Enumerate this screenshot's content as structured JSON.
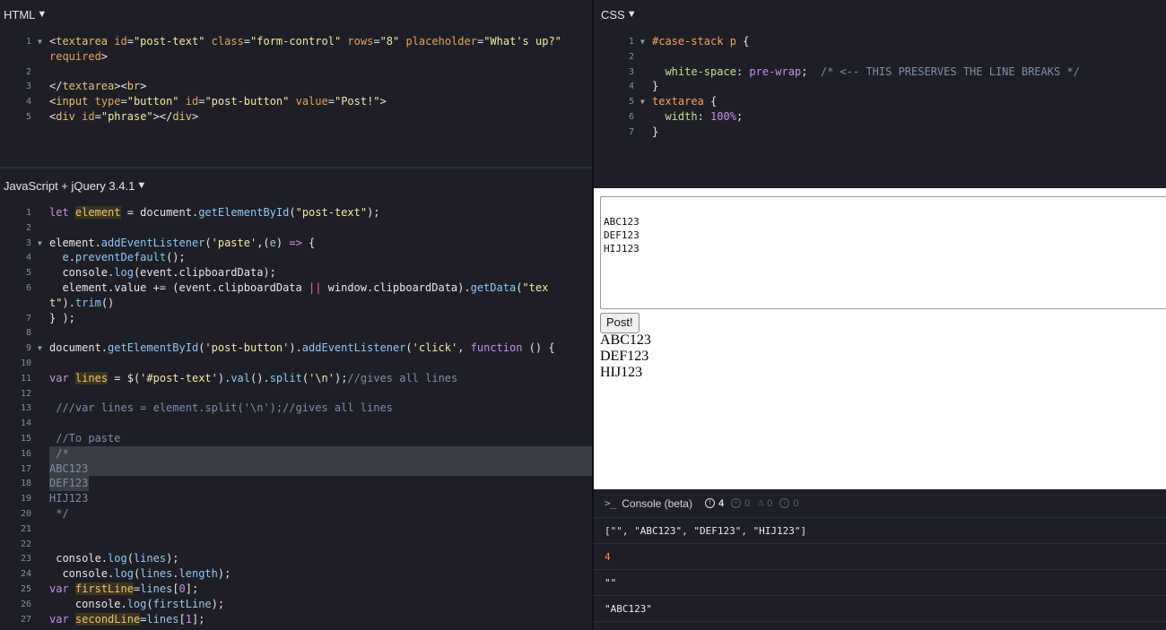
{
  "html_panel": {
    "title": "HTML",
    "lines": [
      {
        "n": "1",
        "fold": true,
        "segs": [
          [
            "t",
            "<"
          ],
          [
            "tag",
            "textarea"
          ],
          [
            "t",
            " "
          ],
          [
            "attr",
            "id"
          ],
          [
            "t",
            "="
          ],
          [
            "str",
            "\"post-text\""
          ],
          [
            "t",
            " "
          ],
          [
            "attr",
            "class"
          ],
          [
            "t",
            "="
          ],
          [
            "str",
            "\"form-control\""
          ],
          [
            "t",
            " "
          ],
          [
            "attr",
            "rows"
          ],
          [
            "t",
            "="
          ],
          [
            "str",
            "\"8\""
          ],
          [
            "t",
            " "
          ],
          [
            "attr",
            "placeholder"
          ],
          [
            "t",
            "="
          ],
          [
            "str",
            "\"What's up?\""
          ]
        ]
      },
      {
        "n": "",
        "segs": [
          [
            "attr",
            "required"
          ],
          [
            "t",
            ">"
          ]
        ]
      },
      {
        "n": "2",
        "segs": []
      },
      {
        "n": "3",
        "segs": [
          [
            "t",
            "</"
          ],
          [
            "tag",
            "textarea"
          ],
          [
            "t",
            "><"
          ],
          [
            "tag",
            "br"
          ],
          [
            "t",
            ">"
          ]
        ]
      },
      {
        "n": "4",
        "segs": [
          [
            "t",
            "<"
          ],
          [
            "tag",
            "input"
          ],
          [
            "t",
            " "
          ],
          [
            "attr",
            "type"
          ],
          [
            "t",
            "="
          ],
          [
            "str",
            "\"button\""
          ],
          [
            "t",
            " "
          ],
          [
            "attr",
            "id"
          ],
          [
            "t",
            "="
          ],
          [
            "str",
            "\"post-button\""
          ],
          [
            "t",
            " "
          ],
          [
            "attr",
            "value"
          ],
          [
            "t",
            "="
          ],
          [
            "str",
            "\"Post!\""
          ],
          [
            "t",
            ">"
          ]
        ]
      },
      {
        "n": "5",
        "segs": [
          [
            "t",
            "<"
          ],
          [
            "tag",
            "div"
          ],
          [
            "t",
            " "
          ],
          [
            "attr",
            "id"
          ],
          [
            "t",
            "="
          ],
          [
            "str",
            "\"phrase\""
          ],
          [
            "t",
            "></"
          ],
          [
            "tag",
            "div"
          ],
          [
            "t",
            ">"
          ]
        ]
      }
    ]
  },
  "css_panel": {
    "title": "CSS",
    "lines": [
      {
        "n": "1",
        "fold": true,
        "segs": [
          [
            "sel",
            "#case-stack p"
          ],
          [
            "t",
            " {"
          ]
        ]
      },
      {
        "n": "2",
        "segs": []
      },
      {
        "n": "3",
        "segs": [
          [
            "t",
            "  "
          ],
          [
            "prop",
            "white-space"
          ],
          [
            "t",
            ": "
          ],
          [
            "val",
            "pre-wrap"
          ],
          [
            "t",
            ";  "
          ],
          [
            "cm",
            "/* <-- THIS PRESERVES THE LINE BREAKS */"
          ]
        ]
      },
      {
        "n": "4",
        "segs": [
          [
            "t",
            "}"
          ]
        ]
      },
      {
        "n": "5",
        "fold": true,
        "segs": [
          [
            "sel",
            "textarea"
          ],
          [
            "t",
            " {"
          ]
        ]
      },
      {
        "n": "6",
        "segs": [
          [
            "t",
            "  "
          ],
          [
            "prop",
            "width"
          ],
          [
            "t",
            ": "
          ],
          [
            "val",
            "100%"
          ],
          [
            "t",
            ";"
          ]
        ]
      },
      {
        "n": "7",
        "segs": [
          [
            "t",
            "}"
          ]
        ]
      }
    ]
  },
  "js_panel": {
    "title": "JavaScript + jQuery 3.4.1",
    "lines": [
      {
        "n": "1",
        "segs": [
          [
            "kw",
            "let"
          ],
          [
            "t",
            " "
          ],
          [
            "var",
            "element"
          ],
          [
            "t",
            " = document."
          ],
          [
            "fn",
            "getElementById"
          ],
          [
            "t",
            "("
          ],
          [
            "str",
            "\"post-text\""
          ],
          [
            "t",
            ");"
          ]
        ]
      },
      {
        "n": "2",
        "segs": []
      },
      {
        "n": "3",
        "fold": true,
        "segs": [
          [
            "t",
            "element."
          ],
          [
            "fn",
            "addEventListener"
          ],
          [
            "t",
            "("
          ],
          [
            "str",
            "'paste'"
          ],
          [
            "t",
            ",("
          ],
          [
            "lblue",
            "e"
          ],
          [
            "t",
            ") "
          ],
          [
            "kw",
            "=>"
          ],
          [
            "t",
            " {"
          ]
        ]
      },
      {
        "n": "4",
        "segs": [
          [
            "t",
            "  "
          ],
          [
            "lblue",
            "e"
          ],
          [
            "t",
            "."
          ],
          [
            "fn",
            "preventDefault"
          ],
          [
            "t",
            "();"
          ]
        ]
      },
      {
        "n": "5",
        "segs": [
          [
            "t",
            "  console."
          ],
          [
            "fn",
            "log"
          ],
          [
            "t",
            "(event.clipboardData);"
          ]
        ]
      },
      {
        "n": "6",
        "segs": [
          [
            "t",
            "  element.value += (event.clipboardData "
          ],
          [
            "op",
            "||"
          ],
          [
            "t",
            " window.clipboardData)."
          ],
          [
            "fn",
            "getData"
          ],
          [
            "t",
            "("
          ],
          [
            "str",
            "\"tex"
          ]
        ]
      },
      {
        "n": "",
        "segs": [
          [
            "str",
            "t\""
          ],
          [
            "t",
            ")."
          ],
          [
            "fn",
            "trim"
          ],
          [
            "t",
            "()"
          ]
        ]
      },
      {
        "n": "7",
        "segs": [
          [
            "t",
            "} );"
          ]
        ]
      },
      {
        "n": "8",
        "segs": []
      },
      {
        "n": "9",
        "fold": true,
        "segs": [
          [
            "t",
            "document."
          ],
          [
            "fn",
            "getElementById"
          ],
          [
            "t",
            "("
          ],
          [
            "str",
            "'post-button'"
          ],
          [
            "t",
            ")."
          ],
          [
            "fn",
            "addEventListener"
          ],
          [
            "t",
            "("
          ],
          [
            "str",
            "'click'"
          ],
          [
            "t",
            ", "
          ],
          [
            "kw",
            "function"
          ],
          [
            "t",
            " () {"
          ]
        ]
      },
      {
        "n": "10",
        "segs": []
      },
      {
        "n": "11",
        "segs": [
          [
            "kw",
            "var"
          ],
          [
            "t",
            " "
          ],
          [
            "var",
            "lines"
          ],
          [
            "t",
            " = $("
          ],
          [
            "str",
            "'#post-text'"
          ],
          [
            "t",
            ")."
          ],
          [
            "fn",
            "val"
          ],
          [
            "t",
            "()."
          ],
          [
            "fn",
            "split"
          ],
          [
            "t",
            "("
          ],
          [
            "str",
            "'\\n'"
          ],
          [
            "t",
            ");"
          ],
          [
            "cm",
            "//gives all lines"
          ]
        ]
      },
      {
        "n": "12",
        "segs": []
      },
      {
        "n": "13",
        "segs": [
          [
            "cm",
            " ///var lines = element.split('\\n');//gives all lines"
          ]
        ]
      },
      {
        "n": "14",
        "segs": []
      },
      {
        "n": "15",
        "segs": [
          [
            "cm",
            " //To paste"
          ]
        ]
      },
      {
        "n": "16",
        "hl": true,
        "segs": [
          [
            "cm",
            " /*"
          ]
        ]
      },
      {
        "n": "17",
        "segs": [
          [
            "cm",
            "ABC123"
          ]
        ],
        "hl": true
      },
      {
        "n": "18",
        "segs": [
          [
            "cm",
            "DEF123"
          ]
        ],
        "hlpart": true
      },
      {
        "n": "19",
        "segs": [
          [
            "cm",
            "HIJ123"
          ]
        ]
      },
      {
        "n": "20",
        "segs": [
          [
            "cm",
            " */"
          ]
        ]
      },
      {
        "n": "21",
        "segs": []
      },
      {
        "n": "22",
        "segs": []
      },
      {
        "n": "23",
        "segs": [
          [
            "t",
            " console."
          ],
          [
            "fn",
            "log"
          ],
          [
            "t",
            "("
          ],
          [
            "lblue",
            "lines"
          ],
          [
            "t",
            ");"
          ]
        ]
      },
      {
        "n": "24",
        "segs": [
          [
            "t",
            "  console."
          ],
          [
            "fn",
            "log"
          ],
          [
            "t",
            "("
          ],
          [
            "lblue",
            "lines"
          ],
          [
            "t",
            "."
          ],
          [
            "fn",
            "length"
          ],
          [
            "t",
            ");"
          ]
        ]
      },
      {
        "n": "25",
        "segs": [
          [
            "kw",
            "var"
          ],
          [
            "t",
            " "
          ],
          [
            "var",
            "firstLine"
          ],
          [
            "t",
            "="
          ],
          [
            "lblue",
            "lines"
          ],
          [
            "t",
            "["
          ],
          [
            "val",
            "0"
          ],
          [
            "t",
            "];"
          ]
        ]
      },
      {
        "n": "26",
        "segs": [
          [
            "t",
            "    console."
          ],
          [
            "fn",
            "log"
          ],
          [
            "t",
            "("
          ],
          [
            "lblue",
            "firstLine"
          ],
          [
            "t",
            ");"
          ]
        ]
      },
      {
        "n": "27",
        "segs": [
          [
            "kw",
            "var"
          ],
          [
            "t",
            " "
          ],
          [
            "var",
            "secondLine"
          ],
          [
            "t",
            "="
          ],
          [
            "lblue",
            "lines"
          ],
          [
            "t",
            "["
          ],
          [
            "val",
            "1"
          ],
          [
            "t",
            "];"
          ]
        ]
      }
    ]
  },
  "output": {
    "textarea_value": "ABC123\nDEF123\nHIJ123",
    "button_label": "Post!",
    "phrase_lines": [
      "ABC123",
      "DEF123",
      "HIJ123"
    ]
  },
  "console": {
    "title": "Console (beta)",
    "prompt": ">_",
    "counts": {
      "info": "4",
      "errors": "0",
      "warnings": "0",
      "logs": "0"
    },
    "entries": [
      {
        "text": "[\"\", \"ABC123\", \"DEF123\", \"HIJ123\"]",
        "kind": "array"
      },
      {
        "text": "4",
        "kind": "number"
      },
      {
        "text": "\"\"",
        "kind": "string"
      },
      {
        "text": "\"ABC123\"",
        "kind": "string"
      }
    ]
  },
  "colors": {
    "editor_bg": "#1e1f26",
    "number_accent": "#f08a55"
  }
}
